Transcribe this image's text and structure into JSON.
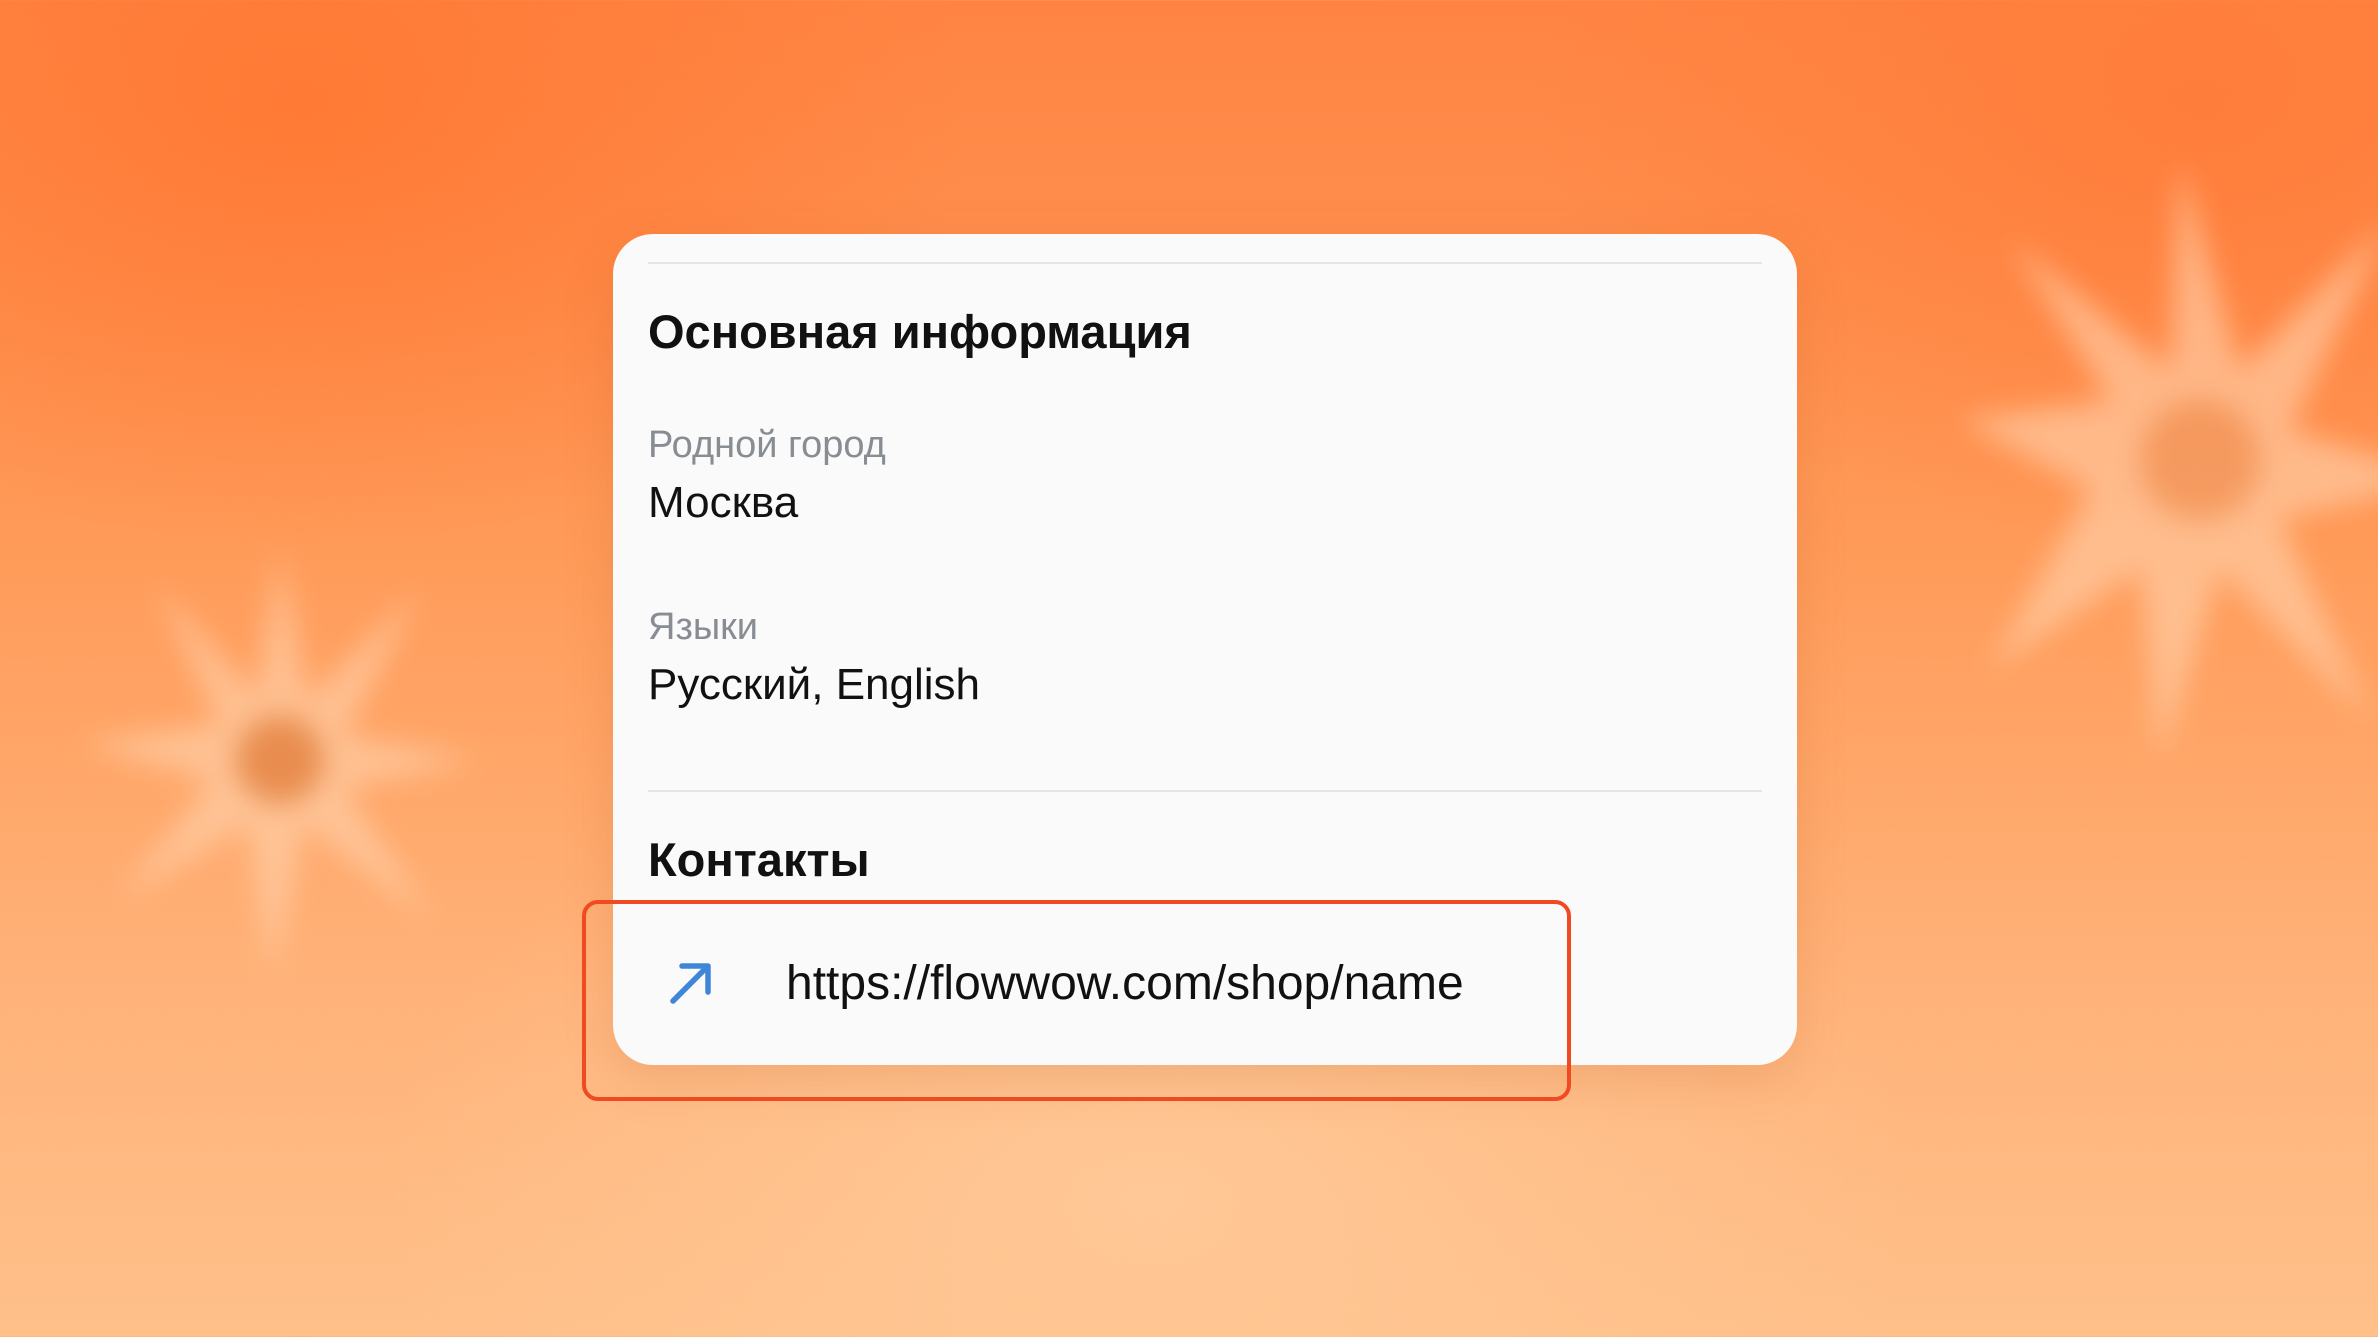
{
  "colors": {
    "background_accent": "#ff8443",
    "card_background": "#fafafa",
    "highlight_border": "#f04a22",
    "link_icon": "#3f86d8"
  },
  "main_info": {
    "title": "Основная информация",
    "hometown": {
      "label": "Родной город",
      "value": "Москва"
    },
    "languages": {
      "label": "Языки",
      "value": "Русский, English"
    }
  },
  "contacts": {
    "title": "Контакты",
    "link": {
      "icon": "arrow-up-right-icon",
      "url": "https://flowwow.com/shop/name"
    }
  }
}
